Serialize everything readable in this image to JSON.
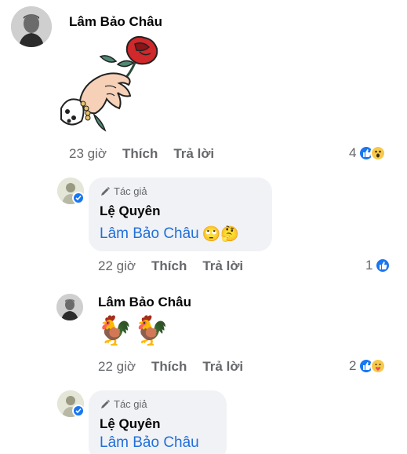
{
  "comments": [
    {
      "author": "Lâm Bảo Châu",
      "sticker_icon": "hand-holding-rose-sticker",
      "time": "23 giờ",
      "like_label": "Thích",
      "reply_label": "Trả lời",
      "reaction_count": "4",
      "reactions": [
        "like",
        "wow"
      ]
    },
    {
      "author_tag": "Tác giả",
      "author": "Lệ Quyên",
      "mention": "Lâm Bảo Châu",
      "emoji": "🙄🤔",
      "time": "22 giờ",
      "like_label": "Thích",
      "reply_label": "Trả lời",
      "reaction_count": "1",
      "reactions": [
        "like"
      ]
    },
    {
      "author": "Lâm Bảo Châu",
      "text_emoji": "🐓🐓",
      "time": "22 giờ",
      "like_label": "Thích",
      "reply_label": "Trả lời",
      "reaction_count": "2",
      "reactions": [
        "like",
        "care"
      ]
    },
    {
      "author_tag": "Tác giả",
      "author": "Lệ Quyên",
      "mention": "Lâm Bảo Châu"
    }
  ],
  "colors": {
    "accent": "#1877f2",
    "mention": "#216fdb",
    "meta": "#65676b",
    "bubble": "#f0f2f5"
  }
}
